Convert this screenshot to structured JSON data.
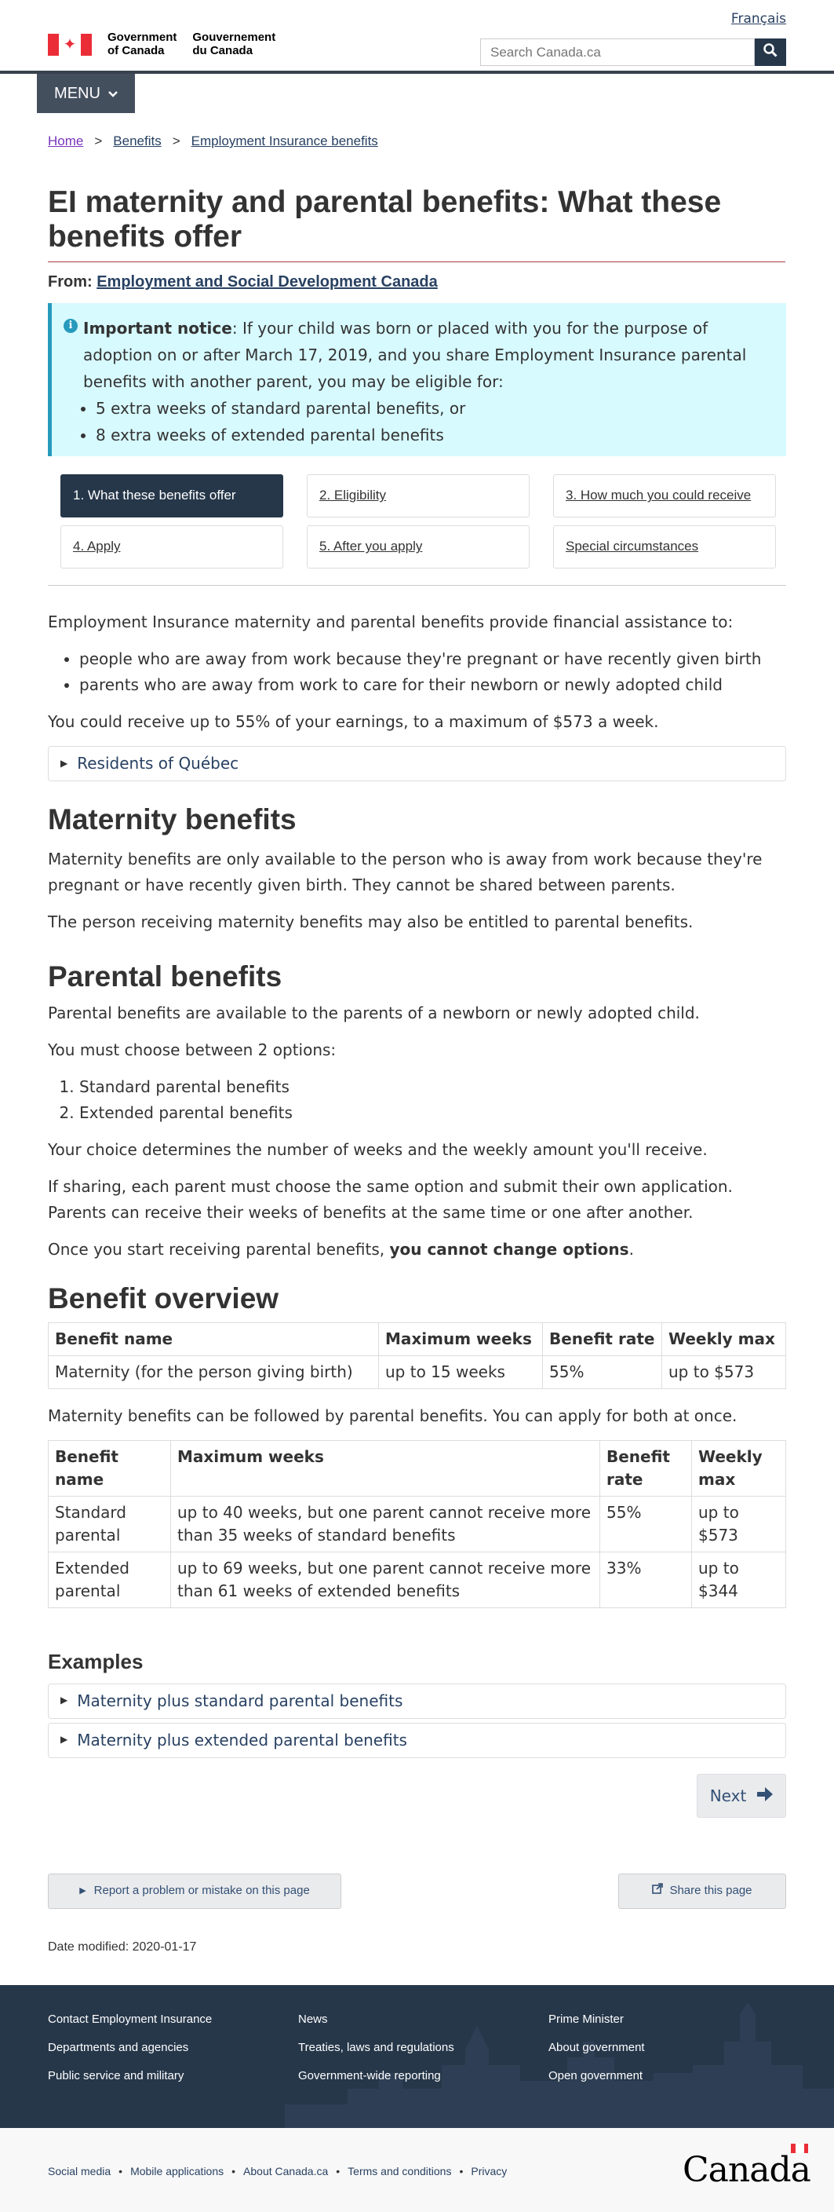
{
  "header": {
    "language_link": "Français",
    "signature_en_1": "Government",
    "signature_en_2": "of Canada",
    "signature_fr_1": "Gouvernement",
    "signature_fr_2": "du Canada",
    "search_placeholder": "Search Canada.ca",
    "menu_label": "MENU"
  },
  "breadcrumb": [
    "Home",
    "Benefits",
    "Employment Insurance benefits"
  ],
  "page": {
    "title": "EI maternity and parental benefits: What these benefits offer",
    "from_label": "From: ",
    "from_link": "Employment and Social Development Canada"
  },
  "notice": {
    "label": "Important notice",
    "text": ": If your child was born or placed with you for the purpose of adoption on or after March 17, 2019, and you share Employment Insurance parental benefits with another parent, you may be eligible for:",
    "items": [
      "5 extra weeks of standard parental benefits, or",
      "8 extra weeks of extended parental benefits"
    ]
  },
  "steps": [
    "1. What these benefits offer",
    "2. Eligibility",
    "3. How much you could receive",
    "4. Apply",
    "5. After you apply",
    "Special circumstances"
  ],
  "intro": {
    "lead": "Employment Insurance maternity and parental benefits provide financial assistance to:",
    "items": [
      "people who are away from work because they're pregnant or have recently given birth",
      "parents who are away from work to care for their newborn or newly adopted child"
    ],
    "earnings": "You could receive up to 55% of your earnings, to a maximum of $573 a week.",
    "quebec": "Residents of Québec"
  },
  "maternity": {
    "heading": "Maternity benefits",
    "p1": "Maternity benefits are only available to the person who is away from work because they're pregnant or have recently given birth. They cannot be shared between parents.",
    "p2": "The person receiving maternity benefits may also be entitled to parental benefits."
  },
  "parental": {
    "heading": "Parental benefits",
    "p1": "Parental benefits are available to the parents of a newborn or newly adopted child.",
    "p2": "You must choose between 2 options:",
    "options": [
      "Standard parental benefits",
      "Extended parental benefits"
    ],
    "p3": "Your choice determines the number of weeks and the weekly amount you'll receive.",
    "p4": "If sharing, each parent must choose the same option and submit their own application. Parents can receive their weeks of benefits at the same time or one after another.",
    "p5_start": "Once you start receiving parental benefits, ",
    "p5_bold": "you cannot change options",
    "p5_end": "."
  },
  "overview": {
    "heading": "Benefit overview",
    "headers": [
      "Benefit name",
      "Maximum weeks",
      "Benefit rate",
      "Weekly max"
    ],
    "row": [
      "Maternity (for the person giving birth)",
      "up to 15 weeks",
      "55%",
      "up to $573"
    ],
    "between": "Maternity benefits can be followed by parental benefits. You can apply for both at once.",
    "rows2": [
      [
        "Standard parental",
        "up to 40 weeks, but one parent cannot receive more than 35 weeks of standard benefits",
        "55%",
        "up to $573"
      ],
      [
        "Extended parental",
        "up to 69 weeks, but one parent cannot receive more than 61 weeks of extended benefits",
        "33%",
        "up to $344"
      ]
    ]
  },
  "examples": {
    "heading": "Examples",
    "items": [
      "Maternity plus standard parental benefits",
      "Maternity plus extended parental benefits"
    ]
  },
  "next_label": "Next",
  "report_label": "Report a problem or mistake on this page",
  "share_label": "Share this page",
  "date_modified": "Date modified: 2020-01-17",
  "footer_links": [
    "Contact Employment Insurance",
    "News",
    "Prime Minister",
    "Departments and agencies",
    "Treaties, laws and regulations",
    "About government",
    "Public service and military",
    "Government-wide reporting",
    "Open government"
  ],
  "sub_links": [
    "Social media",
    "Mobile applications",
    "About Canada.ca",
    "Terms and conditions",
    "Privacy"
  ],
  "wordmark": "Canada",
  "colors": {
    "header_dark": "#26374a",
    "link": "#284162",
    "notice_bg": "#d7faff",
    "notice_border": "#269abc",
    "title_rule": "#af3c43",
    "flag_red": "#eb2d37"
  }
}
